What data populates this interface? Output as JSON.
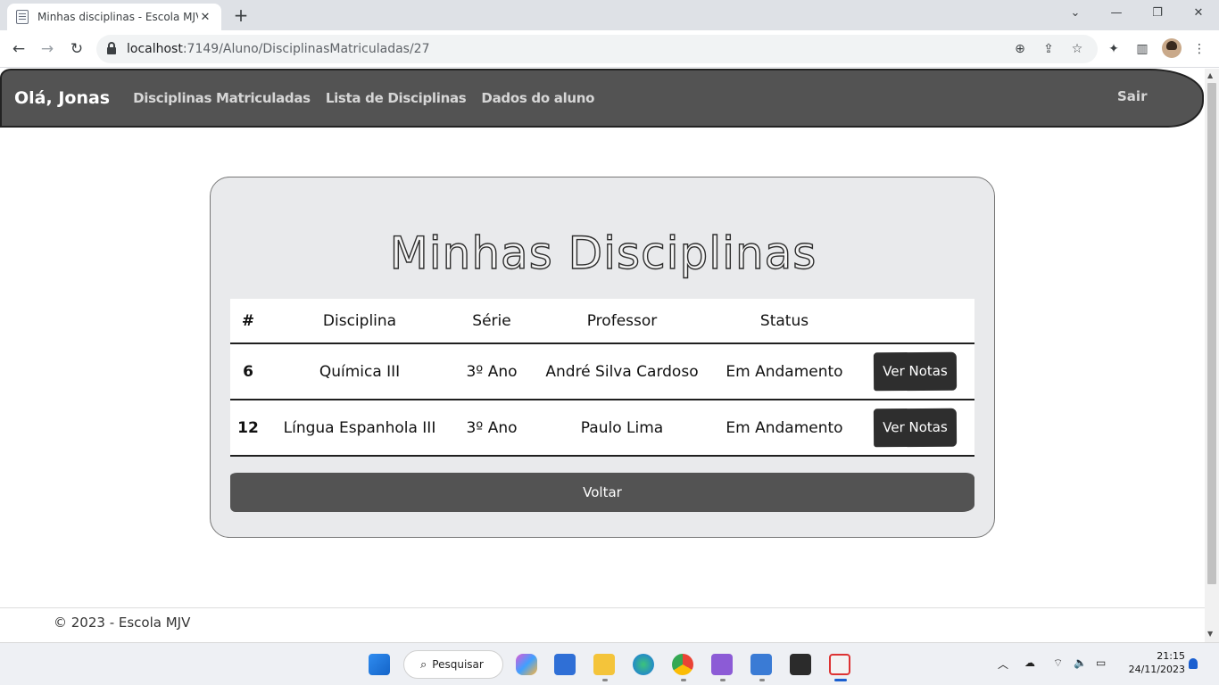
{
  "browser": {
    "tab_title": "Minhas disciplinas - Escola MJV",
    "url_host": "localhost",
    "url_path": ":7149/Aluno/DisciplinasMatriculadas/27"
  },
  "nav": {
    "greeting": "Olá, Jonas",
    "links": [
      "Disciplinas Matriculadas",
      "Lista de Disciplinas",
      "Dados do aluno"
    ],
    "logout": "Sair"
  },
  "page": {
    "title": "Minhas Disciplinas",
    "columns": [
      "#",
      "Disciplina",
      "Série",
      "Professor",
      "Status",
      ""
    ],
    "rows": [
      {
        "id": "6",
        "disciplina": "Química III",
        "serie": "3º Ano",
        "professor": "André Silva Cardoso",
        "status": "Em Andamento",
        "action": "Ver Notas"
      },
      {
        "id": "12",
        "disciplina": "Língua Espanhola III",
        "serie": "3º Ano",
        "professor": "Paulo Lima",
        "status": "Em Andamento",
        "action": "Ver Notas"
      }
    ],
    "back_button": "Voltar"
  },
  "footer": {
    "text": "© 2023 - Escola MJV"
  },
  "taskbar": {
    "search_label": "Pesquisar",
    "time": "21:15",
    "date": "24/11/2023"
  },
  "colors": {
    "navbar": "#535353",
    "card": "#e9eaec",
    "button_dark": "#2e2e2e"
  }
}
